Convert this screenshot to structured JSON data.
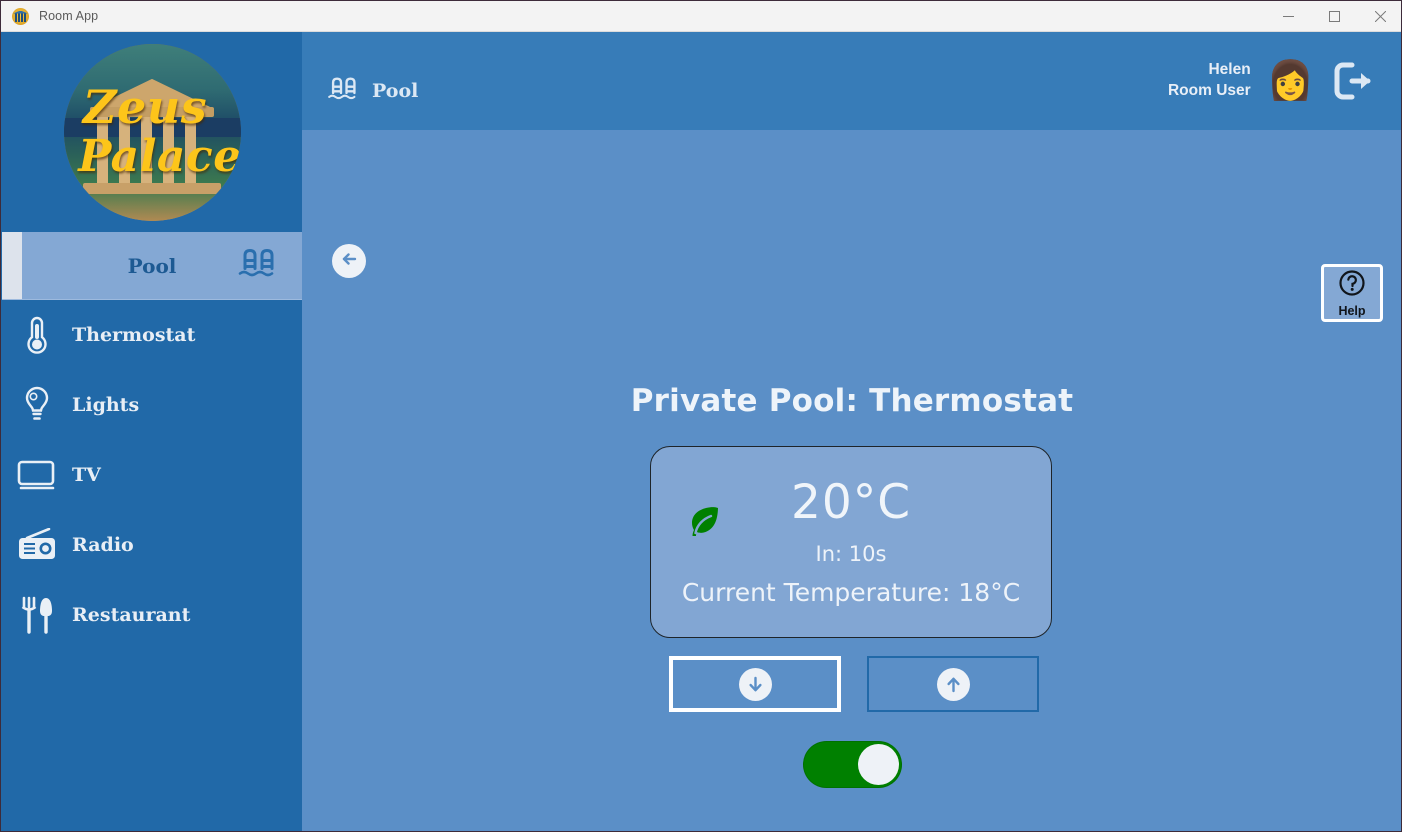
{
  "window": {
    "title": "Room App",
    "app_icon": "zeus-palace-logo-icon",
    "controls": {
      "minimize": "minimize-icon",
      "maximize": "maximize-icon",
      "close": "close-icon"
    }
  },
  "sidebar": {
    "logo": {
      "line1": "Zeus",
      "line2": "Palace"
    },
    "items": [
      {
        "label": "Pool",
        "icon": "pool-ladder-icon",
        "active": true
      },
      {
        "label": "Thermostat",
        "icon": "thermometer-icon",
        "active": false
      },
      {
        "label": "Lights",
        "icon": "lightbulb-icon",
        "active": false
      },
      {
        "label": "TV",
        "icon": "tv-icon",
        "active": false
      },
      {
        "label": "Radio",
        "icon": "radio-icon",
        "active": false
      },
      {
        "label": "Restaurant",
        "icon": "fork-knife-icon",
        "active": false
      }
    ]
  },
  "header": {
    "breadcrumb_icon": "pool-ladder-icon",
    "breadcrumb": "Pool",
    "user": {
      "name": "Helen",
      "role": "Room User",
      "avatar_icon": "woman-avatar-icon"
    },
    "logout_icon": "logout-arrow-icon"
  },
  "toolbar": {
    "back_icon": "back-arrow-icon",
    "help_label": "Help",
    "help_icon": "question-mark-circle-icon"
  },
  "main": {
    "page_title": "Private Pool: Thermostat",
    "thermostat": {
      "eco_icon": "green-leaf-icon",
      "target_temperature": "20°C",
      "countdown": "In: 10s",
      "current_temperature": "Current Temperature: 18°C"
    },
    "controls": {
      "decrease_icon": "arrow-down-circle-icon",
      "increase_icon": "arrow-up-circle-icon",
      "power_toggle": {
        "state": "on",
        "color": "#008000"
      }
    }
  },
  "colors": {
    "sidebar": "#2169a8",
    "header": "#377cb8",
    "content": "#5b8fc7",
    "card": "#82a6d3",
    "active_item": "#84a8d4",
    "toggle_on": "#008000",
    "leaf_green": "#008000",
    "logo_gold": "#fdc51a"
  }
}
